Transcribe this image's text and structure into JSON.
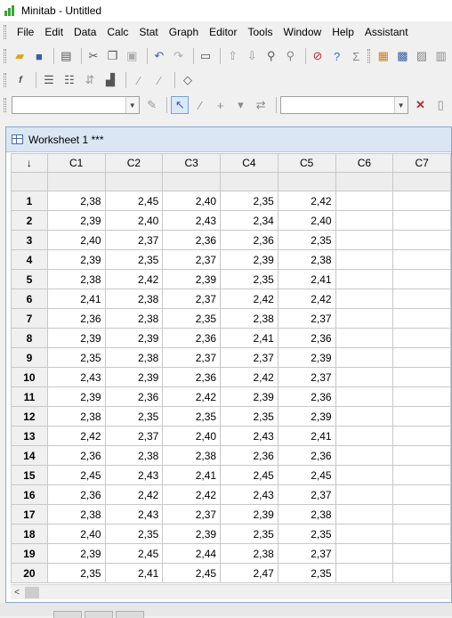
{
  "window": {
    "title": "Minitab - Untitled"
  },
  "menu": [
    "File",
    "Edit",
    "Data",
    "Calc",
    "Stat",
    "Graph",
    "Editor",
    "Tools",
    "Window",
    "Help",
    "Assistant"
  ],
  "worksheet": {
    "title": "Worksheet 1 ***",
    "corner": "↓",
    "columns": [
      "C1",
      "C2",
      "C3",
      "C4",
      "C5",
      "C6",
      "C7"
    ],
    "rows": [
      [
        "1",
        "2,38",
        "2,45",
        "2,40",
        "2,35",
        "2,42"
      ],
      [
        "2",
        "2,39",
        "2,40",
        "2,43",
        "2,34",
        "2,40"
      ],
      [
        "3",
        "2,40",
        "2,37",
        "2,36",
        "2,36",
        "2,35"
      ],
      [
        "4",
        "2,39",
        "2,35",
        "2,37",
        "2,39",
        "2,38"
      ],
      [
        "5",
        "2,38",
        "2,42",
        "2,39",
        "2,35",
        "2,41"
      ],
      [
        "6",
        "2,41",
        "2,38",
        "2,37",
        "2,42",
        "2,42"
      ],
      [
        "7",
        "2,36",
        "2,38",
        "2,35",
        "2,38",
        "2,37"
      ],
      [
        "8",
        "2,39",
        "2,39",
        "2,36",
        "2,41",
        "2,36"
      ],
      [
        "9",
        "2,35",
        "2,38",
        "2,37",
        "2,37",
        "2,39"
      ],
      [
        "10",
        "2,43",
        "2,39",
        "2,36",
        "2,42",
        "2,37"
      ],
      [
        "11",
        "2,39",
        "2,36",
        "2,42",
        "2,39",
        "2,36"
      ],
      [
        "12",
        "2,38",
        "2,35",
        "2,35",
        "2,35",
        "2,39"
      ],
      [
        "13",
        "2,42",
        "2,37",
        "2,40",
        "2,43",
        "2,41"
      ],
      [
        "14",
        "2,36",
        "2,38",
        "2,38",
        "2,36",
        "2,36"
      ],
      [
        "15",
        "2,45",
        "2,43",
        "2,41",
        "2,45",
        "2,45"
      ],
      [
        "16",
        "2,36",
        "2,42",
        "2,42",
        "2,43",
        "2,37"
      ],
      [
        "17",
        "2,38",
        "2,43",
        "2,37",
        "2,39",
        "2,38"
      ],
      [
        "18",
        "2,40",
        "2,35",
        "2,39",
        "2,35",
        "2,35"
      ],
      [
        "19",
        "2,39",
        "2,45",
        "2,44",
        "2,38",
        "2,37"
      ],
      [
        "20",
        "2,35",
        "2,41",
        "2,45",
        "2,47",
        "2,35"
      ]
    ]
  },
  "scroll": {
    "left_arrow": "<"
  }
}
